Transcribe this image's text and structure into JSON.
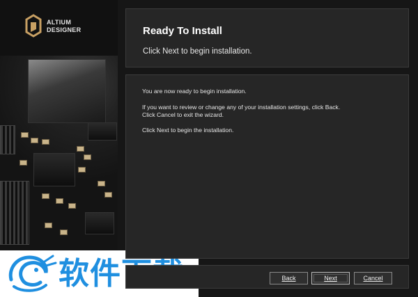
{
  "brand": {
    "line1": "ALTIUM",
    "line2": "DESIGNER",
    "logo_icon": "altium-logo-icon"
  },
  "header": {
    "title": "Ready To Install",
    "subtitle": "Click Next to begin installation."
  },
  "content": {
    "para1": "You are now ready to begin installation.",
    "para2_line1": "If you want to review or change any of your installation settings, click Back.",
    "para2_line2": "Click Cancel to exit the wizard.",
    "para3": "Click Next to begin the installation."
  },
  "buttons": {
    "back": "Back",
    "next": "Next",
    "cancel": "Cancel"
  },
  "watermark": {
    "text": "软件下载",
    "icon": "dragon-icon"
  },
  "colors": {
    "background": "#161616",
    "panel": "#262626",
    "accent_gold": "#c8a063",
    "watermark_blue": "#1f8fe0"
  }
}
